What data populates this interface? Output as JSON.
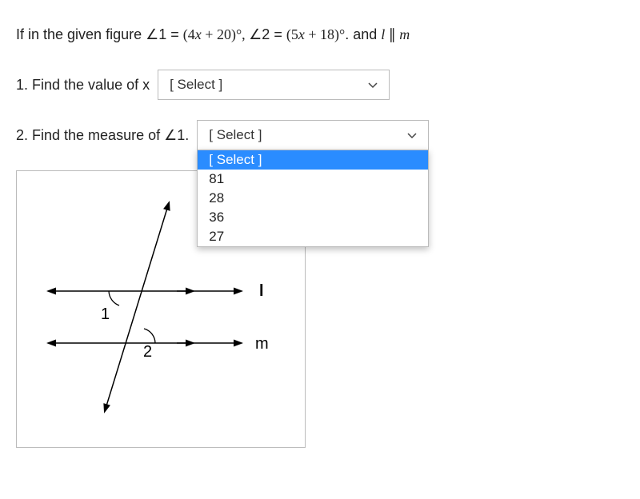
{
  "stem": {
    "prefix": "If in the given figure ",
    "angle1_lhs": "∠1",
    "eq": " = ",
    "angle1_rhs_open": "(4",
    "x1": "x",
    "angle1_rhs_mid": " + 20)",
    "deg": "°",
    "comma": ", ",
    "angle2_lhs": "∠2",
    "angle2_rhs_open": "(5",
    "x2": "x",
    "angle2_rhs_mid": " + 18)",
    "period": ". and ",
    "l": "l",
    "par": " ∥ ",
    "m": "m"
  },
  "q1": {
    "label": "1. Find the value of x",
    "placeholder": "[ Select ]"
  },
  "q2": {
    "label_prefix": "2. Find the measure of ",
    "angle": "∠1",
    "label_suffix": ".",
    "placeholder": "[ Select ]",
    "options": [
      "[ Select ]",
      "81",
      "28",
      "36",
      "27"
    ]
  },
  "figure": {
    "angle1": "1",
    "angle2": "2",
    "line_l": "l",
    "line_m": "m"
  }
}
